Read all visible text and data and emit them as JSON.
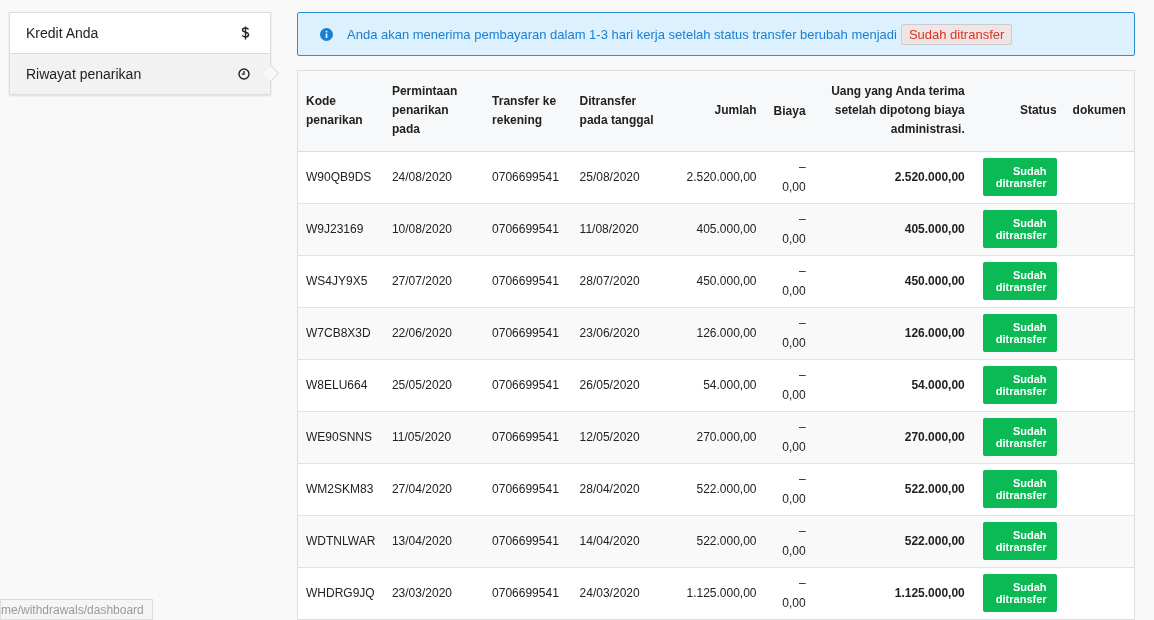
{
  "sidebar": {
    "items": [
      {
        "label": "Kredit Anda",
        "kind": "dollar",
        "selected": false
      },
      {
        "label": "Riwayat penarikan",
        "kind": "clock",
        "selected": true
      }
    ]
  },
  "alert": {
    "text": "Anda akan menerima pembayaran dalam 1-3 hari kerja setelah status transfer berubah menjadi",
    "badge": "Sudah ditransfer"
  },
  "table": {
    "columns": [
      "Kode penarikan",
      "Permintaan penarikan pada",
      "Transfer ke rekening",
      "Ditransfer pada tanggal",
      "Jumlah",
      "Biaya",
      "Uang yang Anda terima setelah dipotong biaya administrasi.",
      "Status",
      "dokumen"
    ],
    "rows": [
      {
        "kode": "W90QB9DS",
        "permintaan": "24/08/2020",
        "rekening": "0706699541",
        "ditransfer": "25/08/2020",
        "jumlah": "2.520.000,00",
        "biaya": "– 0,00",
        "diterima": "2.520.000,00",
        "status": "Sudah ditransfer"
      },
      {
        "kode": "W9J23169",
        "permintaan": "10/08/2020",
        "rekening": "0706699541",
        "ditransfer": "11/08/2020",
        "jumlah": "405.000,00",
        "biaya": "– 0,00",
        "diterima": "405.000,00",
        "status": "Sudah ditransfer"
      },
      {
        "kode": "WS4JY9X5",
        "permintaan": "27/07/2020",
        "rekening": "0706699541",
        "ditransfer": "28/07/2020",
        "jumlah": "450.000,00",
        "biaya": "– 0,00",
        "diterima": "450.000,00",
        "status": "Sudah ditransfer"
      },
      {
        "kode": "W7CB8X3D",
        "permintaan": "22/06/2020",
        "rekening": "0706699541",
        "ditransfer": "23/06/2020",
        "jumlah": "126.000,00",
        "biaya": "– 0,00",
        "diterima": "126.000,00",
        "status": "Sudah ditransfer"
      },
      {
        "kode": "W8ELU664",
        "permintaan": "25/05/2020",
        "rekening": "0706699541",
        "ditransfer": "26/05/2020",
        "jumlah": "54.000,00",
        "biaya": "– 0,00",
        "diterima": "54.000,00",
        "status": "Sudah ditransfer"
      },
      {
        "kode": "WE90SNNS",
        "permintaan": "11/05/2020",
        "rekening": "0706699541",
        "ditransfer": "12/05/2020",
        "jumlah": "270.000,00",
        "biaya": "– 0,00",
        "diterima": "270.000,00",
        "status": "Sudah ditransfer"
      },
      {
        "kode": "WM2SKM83",
        "permintaan": "27/04/2020",
        "rekening": "0706699541",
        "ditransfer": "28/04/2020",
        "jumlah": "522.000,00",
        "biaya": "– 0,00",
        "diterima": "522.000,00",
        "status": "Sudah ditransfer"
      },
      {
        "kode": "WDTNLWAR",
        "permintaan": "13/04/2020",
        "rekening": "0706699541",
        "ditransfer": "14/04/2020",
        "jumlah": "522.000,00",
        "biaya": "– 0,00",
        "diterima": "522.000,00",
        "status": "Sudah ditransfer"
      },
      {
        "kode": "WHDRG9JQ",
        "permintaan": "23/03/2020",
        "rekening": "0706699541",
        "ditransfer": "24/03/2020",
        "jumlah": "1.125.000,00",
        "biaya": "– 0,00",
        "diterima": "1.125.000,00",
        "status": "Sudah ditransfer"
      }
    ]
  },
  "status_bar": {
    "url": "me/withdrawals/dashboard"
  }
}
